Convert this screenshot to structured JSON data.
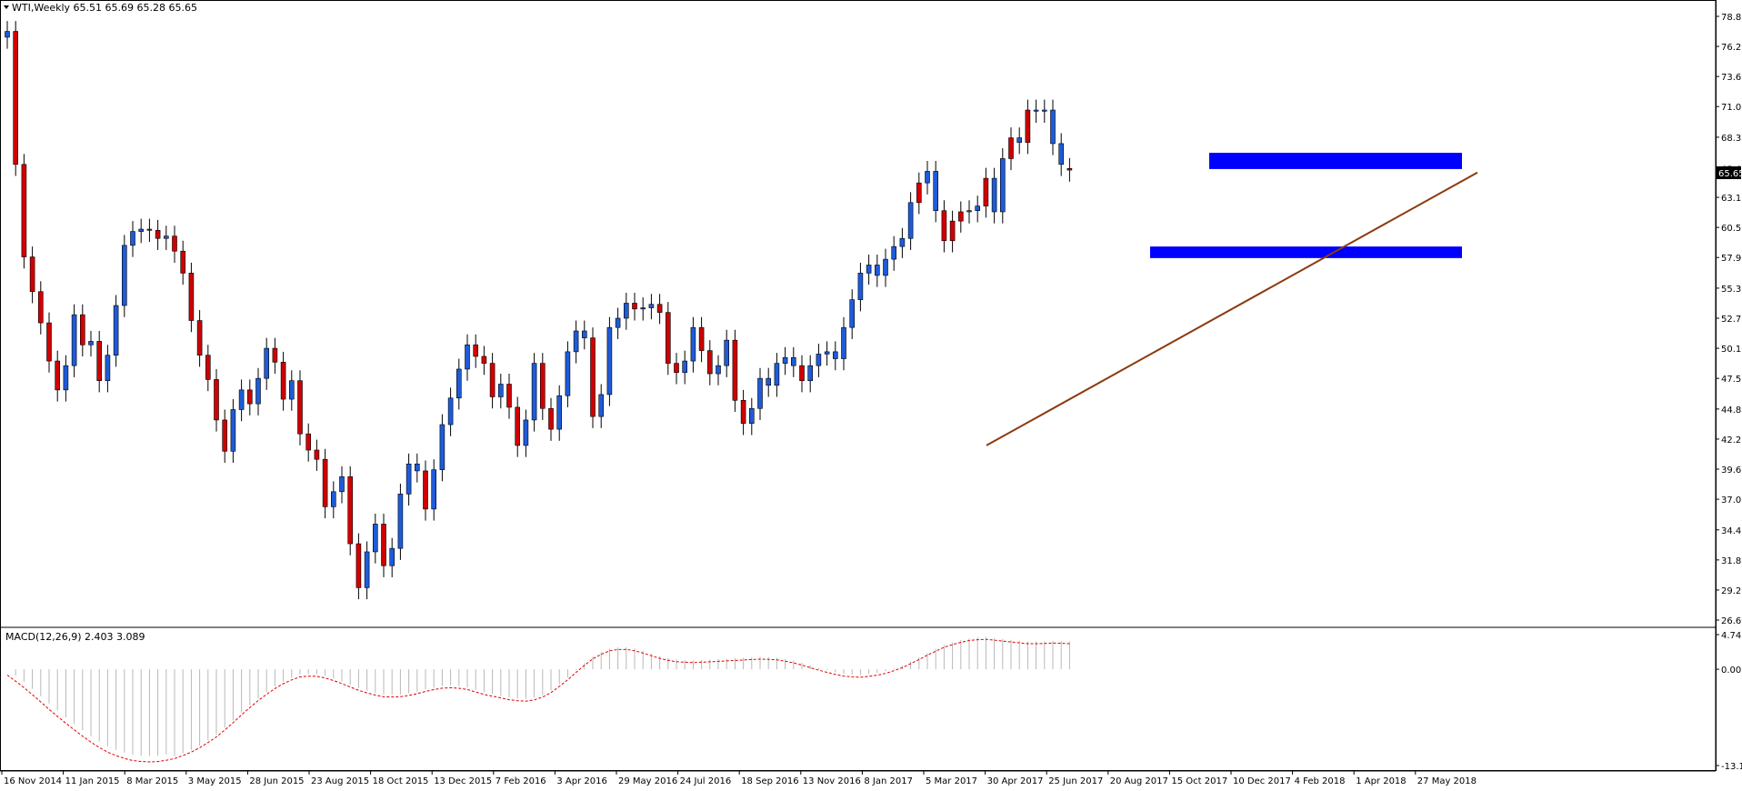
{
  "main_legend": "WTI,Weekly  65.51 65.69 65.28 65.65",
  "macd_legend": "MACD(12,26,9) 2.403 3.089",
  "current_price_label": "65.65",
  "chart_data": {
    "type": "candlestick",
    "symbol": "WTI",
    "timeframe": "Weekly",
    "last_bar": {
      "open": 65.51,
      "high": 65.69,
      "low": 65.28,
      "close": 65.65
    },
    "ylim": [
      26.6,
      78.8
    ],
    "y_ticks": [
      "78.80",
      "76.20",
      "73.60",
      "71.00",
      "68.35",
      "65.65",
      "63.15",
      "60.55",
      "57.95",
      "55.30",
      "52.70",
      "50.10",
      "47.50",
      "44.85",
      "42.25",
      "39.65",
      "37.05",
      "34.40",
      "31.80",
      "29.20",
      "26.60"
    ],
    "x_labels": [
      "16 Nov 2014",
      "11 Jan 2015",
      "8 Mar 2015",
      "3 May 2015",
      "28 Jun 2015",
      "23 Aug 2015",
      "18 Oct 2015",
      "13 Dec 2015",
      "7 Feb 2016",
      "3 Apr 2016",
      "29 May 2016",
      "24 Jul 2016",
      "18 Sep 2016",
      "13 Nov 2016",
      "8 Jan 2017",
      "5 Mar 2017",
      "30 Apr 2017",
      "25 Jun 2017",
      "20 Aug 2017",
      "15 Oct 2017",
      "10 Dec 2017",
      "4 Feb 2018",
      "1 Apr 2018",
      "27 May 2018"
    ],
    "closes": [
      77.5,
      66.0,
      58.0,
      55.0,
      52.3,
      49.0,
      46.5,
      48.6,
      53.0,
      50.4,
      50.7,
      47.3,
      49.5,
      53.8,
      59.0,
      60.2,
      60.4,
      60.3,
      59.6,
      59.8,
      58.5,
      56.6,
      52.5,
      49.5,
      47.4,
      43.9,
      41.2,
      44.8,
      46.5,
      45.3,
      47.5,
      50.1,
      48.9,
      45.7,
      47.3,
      42.7,
      41.3,
      40.5,
      36.4,
      37.7,
      39.0,
      33.2,
      29.4,
      32.5,
      34.9,
      31.3,
      32.8,
      37.5,
      40.1,
      39.5,
      36.2,
      39.6,
      43.5,
      45.8,
      48.3,
      50.4,
      49.4,
      48.8,
      45.9,
      47.0,
      45.0,
      41.7,
      43.9,
      48.8,
      44.9,
      43.1,
      46.0,
      49.8,
      51.6,
      51.0,
      44.2,
      46.1,
      51.9,
      52.7,
      54.0,
      53.5,
      53.6,
      53.9,
      53.2,
      48.8,
      48.0,
      49.0,
      51.9,
      49.9,
      47.9,
      48.6,
      50.8,
      45.6,
      43.6,
      44.9,
      47.5,
      46.9,
      48.8,
      49.3,
      48.6,
      47.3,
      48.6,
      49.6,
      49.8,
      49.2,
      51.9,
      54.3,
      56.6,
      57.3,
      56.4,
      57.8,
      58.9,
      59.6,
      62.7,
      64.4,
      65.4,
      62.0,
      59.4,
      61.1,
      61.9,
      62.0,
      62.4,
      64.8,
      61.9,
      66.5,
      68.3,
      67.9,
      70.7,
      70.6,
      70.7,
      67.8,
      66.0,
      65.65
    ],
    "bear_indices": [
      1,
      2,
      3,
      4,
      5,
      6,
      9,
      11,
      17,
      18,
      20,
      21,
      22,
      23,
      24,
      25,
      26,
      29,
      32,
      33,
      35,
      36,
      37,
      38,
      41,
      42,
      45,
      50,
      56,
      57,
      58,
      60,
      61,
      64,
      65,
      70,
      75,
      78,
      79,
      80,
      83,
      84,
      87,
      88,
      95,
      109,
      112,
      113,
      114,
      117,
      120,
      122,
      127,
      128
    ],
    "support_zones": [
      {
        "y_from": 65.6,
        "y_to": 67.0
      },
      {
        "y_from": 57.9,
        "y_to": 58.9
      }
    ],
    "trendline": {
      "from_index": 126,
      "from_value": 41.7,
      "to_index": 188,
      "to_value": 65.3
    },
    "indicator": {
      "name": "MACD(12,26,9)",
      "main": 2.403,
      "signal": 3.089,
      "ylim": [
        -13.175,
        4.741
      ],
      "y_ticks": [
        "4.741",
        "0.00",
        "-13.175"
      ],
      "signal_series": [
        -0.8,
        -2.2,
        -3.8,
        -5.5,
        -7.1,
        -8.6,
        -10.0,
        -11.2,
        -12.0,
        -12.5,
        -12.7,
        -12.6,
        -12.2,
        -11.5,
        -10.5,
        -9.2,
        -7.6,
        -5.8,
        -4.2,
        -2.8,
        -1.7,
        -1.0,
        -0.9,
        -1.3,
        -2.0,
        -2.8,
        -3.4,
        -3.8,
        -3.8,
        -3.5,
        -3.0,
        -2.6,
        -2.5,
        -2.8,
        -3.4,
        -3.8,
        -4.2,
        -4.4,
        -4.1,
        -3.1,
        -1.6,
        0.1,
        1.6,
        2.5,
        2.8,
        2.5,
        1.9,
        1.3,
        1.0,
        0.9,
        1.0,
        1.1,
        1.2,
        1.3,
        1.4,
        1.3,
        1.0,
        0.5,
        -0.1,
        -0.6,
        -1.0,
        -1.1,
        -0.9,
        -0.5,
        0.2,
        1.1,
        2.1,
        3.0,
        3.6,
        4.0,
        4.1,
        3.9,
        3.7,
        3.5,
        3.5,
        3.6,
        3.5
      ],
      "histogram_max": 4.1,
      "histogram_min": -12.7
    }
  }
}
